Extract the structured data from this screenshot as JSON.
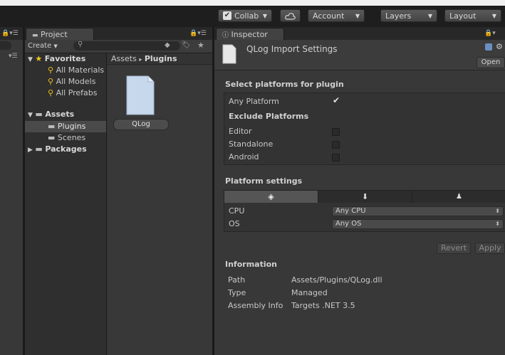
{
  "toolbar": {
    "collab": "Collab",
    "account": "Account",
    "layers": "Layers",
    "layout": "Layout"
  },
  "project": {
    "tab_label": "Project",
    "create_label": "Create",
    "favorites": {
      "label": "Favorites",
      "items": [
        "All Materials",
        "All Models",
        "All Prefabs"
      ]
    },
    "assets": {
      "label": "Assets",
      "children": [
        "Plugins",
        "Scenes"
      ]
    },
    "packages_label": "Packages",
    "breadcrumb": {
      "root": "Assets",
      "separator": "▸",
      "current": "Plugins"
    },
    "file": {
      "name": "QLog"
    }
  },
  "inspector": {
    "tab_label": "Inspector",
    "title": "QLog Import Settings",
    "open_label": "Open",
    "select_platforms_header": "Select platforms for plugin",
    "any_platform_label": "Any Platform",
    "any_platform_checked": true,
    "exclude_header": "Exclude Platforms",
    "exclude": [
      {
        "label": "Editor",
        "checked": false
      },
      {
        "label": "Standalone",
        "checked": false
      },
      {
        "label": "Android",
        "checked": false
      }
    ],
    "platform_settings_header": "Platform settings",
    "platform_tabs": [
      "unity-icon",
      "download-icon",
      "android-icon"
    ],
    "cpu_label": "CPU",
    "cpu_value": "Any CPU",
    "os_label": "OS",
    "os_value": "Any OS",
    "revert_label": "Revert",
    "apply_label": "Apply",
    "information_header": "Information",
    "info": [
      {
        "key": "Path",
        "value": "Assets/Plugins/QLog.dll"
      },
      {
        "key": "Type",
        "value": "Managed"
      },
      {
        "key": "Assembly Info",
        "value": "Targets .NET 3.5"
      }
    ]
  },
  "colors": {
    "selection": "#4a4a4a",
    "background": "#383838",
    "toolbar": "#1e1e1e",
    "favorite_star": "#f5c518"
  }
}
